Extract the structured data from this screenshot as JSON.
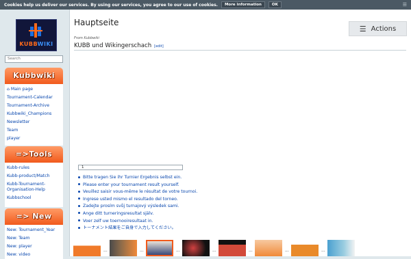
{
  "cookie": {
    "message": "Cookies help us deliver our services. By using our services, you agree to our use of cookies.",
    "more_info": "More information",
    "ok": "OK"
  },
  "sidebar": {
    "logo_text": "KUBBWIKI",
    "search_placeholder": "Search",
    "sections": [
      {
        "banner": "Kubbwiki",
        "items": [
          "Main page",
          "Tournament-Calendar",
          "Tournament-Archive",
          "Kubbwiki_Champions",
          "Newsletter",
          "Team",
          "player"
        ]
      },
      {
        "banner": "=>Tools",
        "items": [
          "Kubb-rules",
          "Kubb-product/Match",
          "Kubb-Tournament-Organisation-Help",
          "Kubbschool"
        ]
      },
      {
        "banner": "=> New",
        "items": [
          "New: Tournament_Year",
          "New: Team",
          "New: player",
          "New: video"
        ]
      }
    ]
  },
  "main": {
    "title": "Hauptseite",
    "actions_label": "Actions",
    "from_line": "From Kubbwiki",
    "subtitle": "KUBB und Wikingerschach",
    "edit_label": "[edit]",
    "input_value": "1",
    "notes": [
      "Bitte tragen Sie ihr Turnier Ergebnis selbst ein.",
      "Please enter your tournament result yourself.",
      "Veuillez saisir vous-même le résultat de votre tournoi.",
      "Ingrese usted mismo el resultado del torneo.",
      "Zadejte prosím svůj turnajový výsledek sami.",
      "Ange ditt turneringsresultat själv.",
      "Voer zelf uw toernooiresultaat in.",
      "トーナメント結果をご自身で入力してください。"
    ],
    "gallery_separator": "..."
  },
  "colors": {
    "banner_orange": "#f15a1c",
    "link_blue": "#0645ad",
    "cookie_bar": "#4b5964"
  }
}
